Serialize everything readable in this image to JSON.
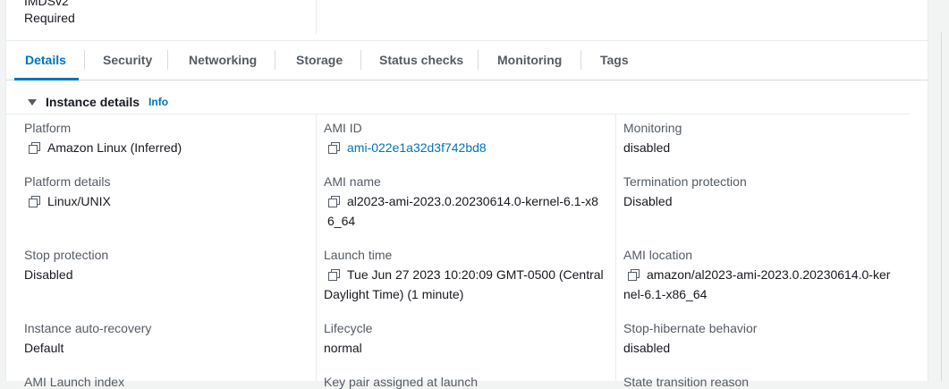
{
  "top_field": {
    "label": "IMDSv2",
    "value": "Required"
  },
  "tabs": [
    "Details",
    "Security",
    "Networking",
    "Storage",
    "Status checks",
    "Monitoring",
    "Tags"
  ],
  "section": {
    "title": "Instance details",
    "info": "Info"
  },
  "fields": {
    "platform": {
      "label": "Platform",
      "value": "Amazon Linux (Inferred)"
    },
    "ami_id": {
      "label": "AMI ID",
      "value": "ami-022e1a32d3f742bd8"
    },
    "monitoring": {
      "label": "Monitoring",
      "value": "disabled"
    },
    "platform_details": {
      "label": "Platform details",
      "value": "Linux/UNIX"
    },
    "ami_name": {
      "label": "AMI name",
      "value": "al2023-ami-2023.0.20230614.0-kernel-6.1-x86_64"
    },
    "termination_protection": {
      "label": "Termination protection",
      "value": "Disabled"
    },
    "stop_protection": {
      "label": "Stop protection",
      "value": "Disabled"
    },
    "launch_time": {
      "label": "Launch time",
      "value": "Tue Jun 27 2023 10:20:09 GMT-0500 (Central Daylight Time) (1 minute)"
    },
    "ami_location": {
      "label": "AMI location",
      "value": "amazon/al2023-ami-2023.0.20230614.0-kernel-6.1-x86_64"
    },
    "auto_recovery": {
      "label": "Instance auto-recovery",
      "value": "Default"
    },
    "lifecycle": {
      "label": "Lifecycle",
      "value": "normal"
    },
    "stop_hibernate": {
      "label": "Stop-hibernate behavior",
      "value": "disabled"
    },
    "ami_launch_index": {
      "label": "AMI Launch index"
    },
    "key_pair": {
      "label": "Key pair assigned at launch"
    },
    "state_transition": {
      "label": "State transition reason"
    }
  }
}
